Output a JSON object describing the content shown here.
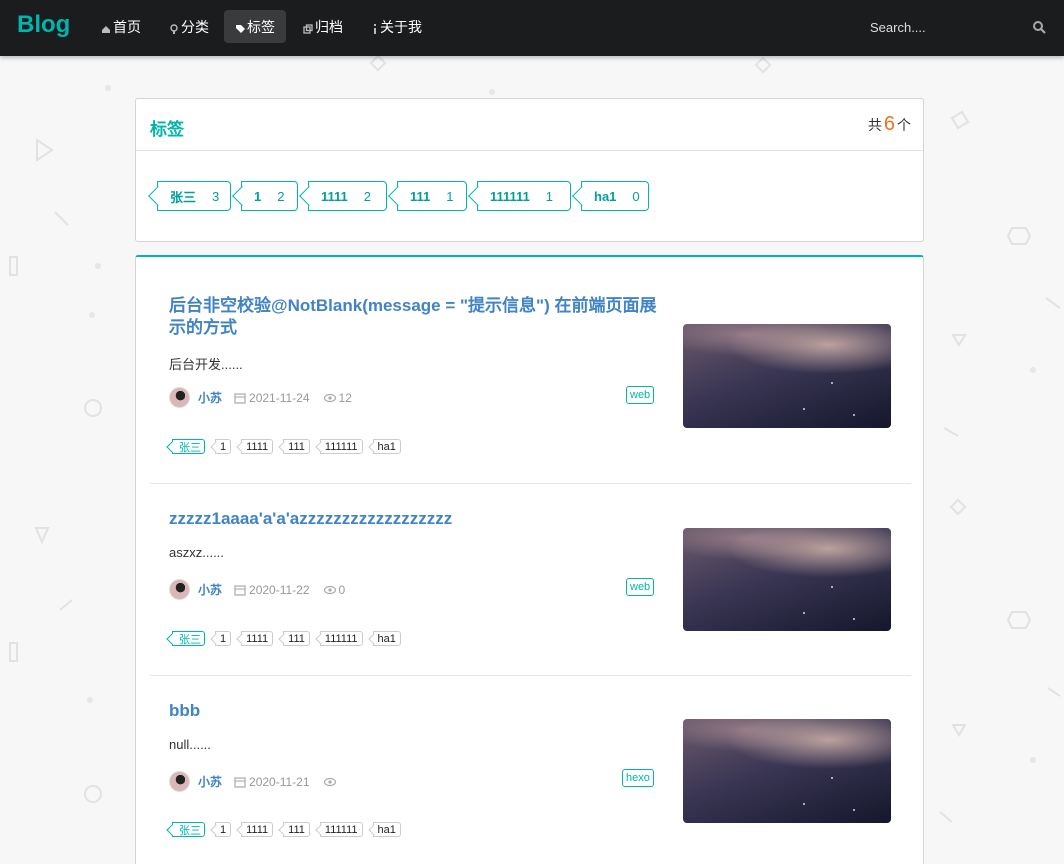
{
  "navbar": {
    "brand": "Blog",
    "items": [
      {
        "label": "首页",
        "icon": "home-icon",
        "active": false
      },
      {
        "label": "分类",
        "icon": "idea-icon",
        "active": false
      },
      {
        "label": "标签",
        "icon": "tags-icon",
        "active": true
      },
      {
        "label": "归档",
        "icon": "clone-icon",
        "active": false
      },
      {
        "label": "关于我",
        "icon": "info-icon",
        "active": false
      }
    ],
    "search_placeholder": "Search....",
    "search_icon": "search-icon"
  },
  "tag_panel": {
    "title": "标签",
    "count_prefix": "共",
    "count": "6",
    "count_suffix": "个",
    "tags": [
      {
        "name": "张三",
        "count": "3"
      },
      {
        "name": "1",
        "count": "2"
      },
      {
        "name": "1111",
        "count": "2"
      },
      {
        "name": "111",
        "count": "1"
      },
      {
        "name": "111111",
        "count": "1"
      },
      {
        "name": "ha1",
        "count": "0"
      }
    ]
  },
  "posts": [
    {
      "title": "后台非空校验@NotBlank(message = \"提示信息\") 在前端页面展示的方式",
      "excerpt": "后台开发......",
      "author": "小苏",
      "date": "2021-11-24",
      "views": "12",
      "category": "web",
      "tags": [
        "张三",
        "1",
        "1111",
        "111",
        "111111",
        "ha1"
      ]
    },
    {
      "title": "zzzzz1aaaa'a'a'azzzzzzzzzzzzzzzzzz",
      "excerpt": "aszxz......",
      "author": "小苏",
      "date": "2020-11-22",
      "views": "0",
      "category": "web",
      "tags": [
        "张三",
        "1",
        "1111",
        "111",
        "111111",
        "ha1"
      ]
    },
    {
      "title": "bbb",
      "excerpt": "null......",
      "author": "小苏",
      "date": "2020-11-21",
      "views": "",
      "category": "hexo",
      "tags": [
        "张三",
        "1",
        "1111",
        "111",
        "111111",
        "ha1"
      ]
    }
  ],
  "colors": {
    "accent": "#00b5ad",
    "link": "#4183c4",
    "count_highlight": "#f2711c",
    "navbar_bg": "#1b1c1d"
  }
}
